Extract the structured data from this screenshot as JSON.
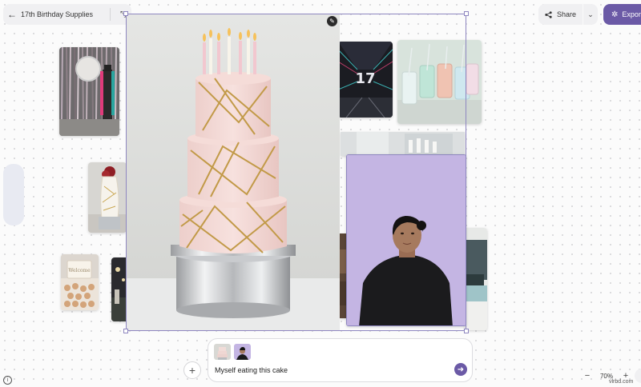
{
  "header": {
    "board_title": "17th Birthday Supplies",
    "share_label": "Share",
    "export_label": "Export"
  },
  "canvas": {
    "images": [
      "photo-booth-tinsel",
      "neon-17-tunnel",
      "pastel-drinks",
      "white-cake-red-flowers",
      "birthday-cookies",
      "party-venue",
      "venue-window",
      "pink-gold-cake-tiers",
      "person-lavender-backdrop",
      "venue-interior"
    ]
  },
  "prompt": {
    "text": "Myself eating this cake"
  },
  "zoom": {
    "level": "70%"
  },
  "watermark": "vlrbd.com",
  "colors": {
    "accent": "#6b5aa6",
    "selection": "#8e86c0"
  }
}
